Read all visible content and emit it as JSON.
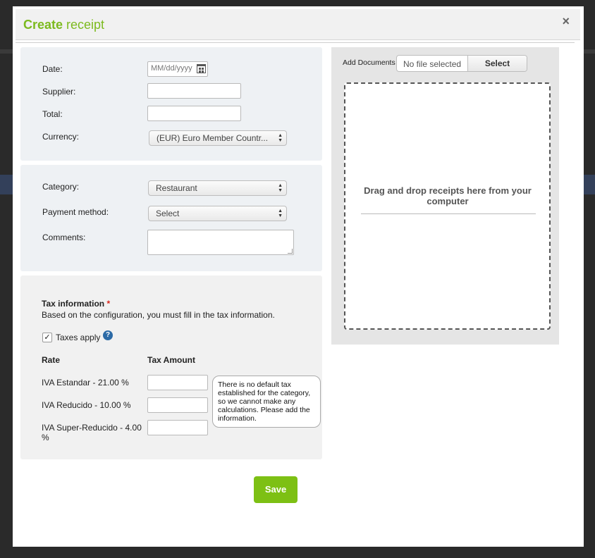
{
  "modal": {
    "title_bold": "Create",
    "title_rest": " receipt",
    "close_glyph": "×"
  },
  "basic": {
    "date_label": "Date:",
    "date_placeholder": "MM/dd/yyyy",
    "supplier_label": "Supplier:",
    "supplier_value": "",
    "total_label": "Total:",
    "total_value": "",
    "currency_label": "Currency:",
    "currency_value": "(EUR) Euro Member Countr..."
  },
  "details": {
    "category_label": "Category:",
    "category_value": "Restaurant",
    "payment_label": "Payment method:",
    "payment_value": "Select",
    "comments_label": "Comments:",
    "comments_value": ""
  },
  "tax": {
    "heading": "Tax information",
    "required_mark": "*",
    "description": "Based on the configuration, you must fill in the tax information.",
    "taxes_apply_label": "Taxes apply",
    "taxes_apply_checked": true,
    "check_glyph": "✓",
    "help_glyph": "?",
    "rate_header": "Rate",
    "amount_header": "Tax Amount",
    "rows": [
      {
        "rate": "IVA Estandar - 21.00 %",
        "amount": ""
      },
      {
        "rate": "IVA Reducido - 10.00 %",
        "amount": ""
      },
      {
        "rate": "IVA Super-Reducido - 4.00 %",
        "amount": ""
      }
    ],
    "tooltip": "There is no default tax established for the category, so we cannot make any calculations. Please add the information."
  },
  "upload": {
    "add_documents_label": "Add Documents",
    "file_status": "No file selected",
    "select_button": "Select",
    "drop_text": "Drag and drop receipts here from your computer"
  },
  "footer": {
    "save_label": "Save"
  },
  "colors": {
    "accent": "#7cba1e",
    "save_button": "#7dc014",
    "help_icon": "#2c6aa6",
    "required": "#d9261c"
  },
  "icons": {
    "calendar": "calendar-icon",
    "close": "close-icon",
    "help": "help-icon",
    "select_arrows": "select-arrows-icon"
  }
}
